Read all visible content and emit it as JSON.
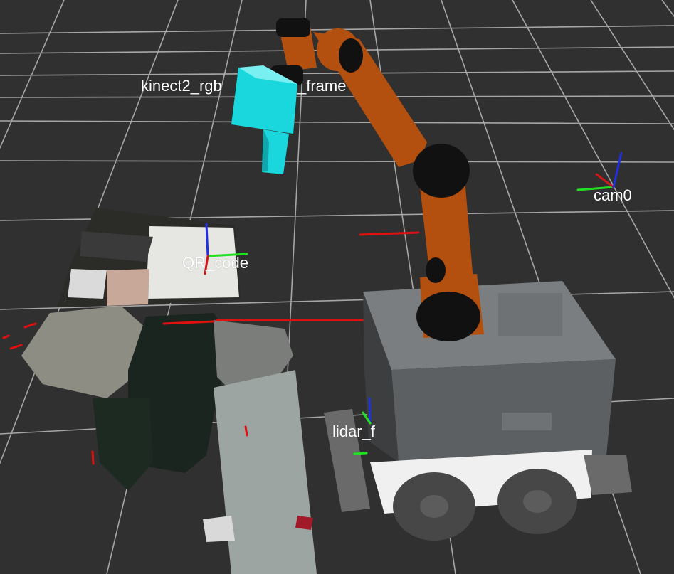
{
  "viewer": {
    "background_color": "#303030",
    "grid_color": "#a0a0a0"
  },
  "frames": {
    "kinect": {
      "label_left": "kinect2_rgb",
      "label_right": "_frame"
    },
    "cam0": {
      "label": "cam0"
    },
    "qr": {
      "label": "QR_code"
    },
    "lidar": {
      "label": "lidar_f"
    }
  },
  "colors": {
    "arm_orange": "#b4500f",
    "arm_joint": "#111111",
    "kinect_cyan": "#19d7dc",
    "base_gray": "#5c6062",
    "base_top": "#7a7e80",
    "wheel": "#4a4a4a",
    "axis_x": "#d01818",
    "axis_y": "#20e020",
    "axis_z": "#2030e0",
    "scan_red": "#e01010"
  }
}
